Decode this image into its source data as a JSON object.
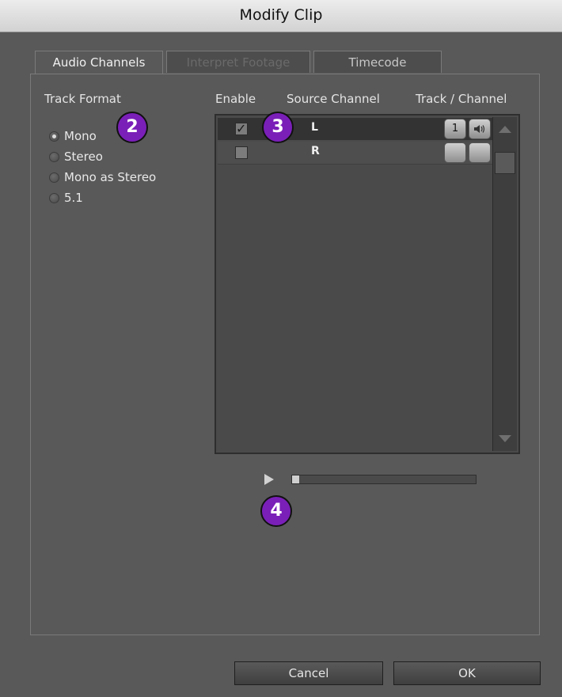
{
  "window": {
    "title": "Modify Clip"
  },
  "tabs": [
    {
      "label": "Audio Channels",
      "state": "active"
    },
    {
      "label": "Interpret Footage",
      "state": "disabled"
    },
    {
      "label": "Timecode",
      "state": "normal"
    }
  ],
  "track_format": {
    "heading": "Track Format",
    "options": [
      {
        "label": "Mono",
        "selected": true
      },
      {
        "label": "Stereo",
        "selected": false
      },
      {
        "label": "Mono as Stereo",
        "selected": false
      },
      {
        "label": "5.1",
        "selected": false
      }
    ]
  },
  "columns": {
    "enable": "Enable",
    "source_channel": "Source Channel",
    "track_channel": "Track / Channel"
  },
  "rows": [
    {
      "enabled": true,
      "source": "L",
      "track": "1",
      "icon": "speaker-icon"
    },
    {
      "enabled": false,
      "source": "R",
      "track": "",
      "icon": ""
    }
  ],
  "playback": {
    "progress": 0.04
  },
  "callouts": {
    "c2": "2",
    "c3": "3",
    "c4": "4",
    "color": "#7a1fb8"
  },
  "buttons": {
    "cancel": "Cancel",
    "ok": "OK"
  }
}
